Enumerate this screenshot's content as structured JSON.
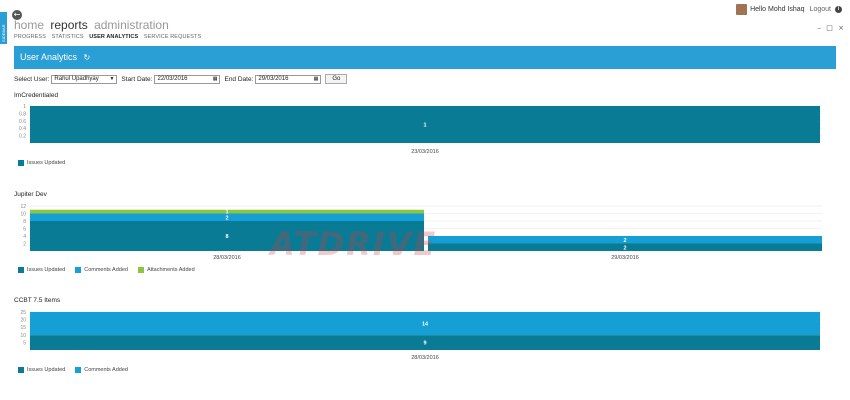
{
  "window": {
    "side_tab_label": "SIDEBAR",
    "controls": [
      "–",
      "□",
      "×"
    ]
  },
  "nav": {
    "back_icon": "back-arrow-icon",
    "top": [
      {
        "label": "home",
        "active": false
      },
      {
        "label": "reports",
        "active": true
      },
      {
        "label": "administration",
        "active": false
      }
    ],
    "sub": [
      {
        "label": "PROGRESS",
        "active": false
      },
      {
        "label": "STATISTICS",
        "active": false
      },
      {
        "label": "USER ANALYTICS",
        "active": true
      },
      {
        "label": "SERVICE REQUESTS",
        "active": false
      }
    ]
  },
  "user": {
    "greeting": "Hello Mohd Ishaq",
    "logout": "Logout",
    "info": "i"
  },
  "banner": {
    "title": "User Analytics",
    "refresh_icon": "refresh-icon"
  },
  "filters": {
    "user_label": "Select User:",
    "user_value": "Rahul  Upadhyay",
    "start_label": "Start Date:",
    "start_value": "22/03/2016",
    "end_label": "End Date:",
    "end_value": "29/03/2016",
    "go_label": "Go"
  },
  "colors": {
    "issues": "#0a7b94",
    "comments": "#159fd4",
    "attachments": "#8cc63f",
    "banner": "#2a9fd6"
  },
  "chart_data": [
    {
      "type": "bar",
      "title": "ImCredentialed",
      "categories": [
        "23/03/2016"
      ],
      "series": [
        {
          "name": "Issues Updated",
          "values": [
            1
          ]
        }
      ],
      "y_ticks": [
        "1",
        "0.8",
        "0.6",
        "0.4",
        "0.2"
      ],
      "ylim": [
        0,
        1
      ]
    },
    {
      "type": "bar",
      "title": "Jupiter Dev",
      "categories": [
        "28/03/2016",
        "29/03/2016"
      ],
      "series": [
        {
          "name": "Issues Updated",
          "values": [
            8,
            2
          ]
        },
        {
          "name": "Comments Added",
          "values": [
            2,
            2
          ]
        },
        {
          "name": "Attachments Added",
          "values": [
            1,
            0
          ]
        }
      ],
      "y_ticks": [
        "12",
        "10",
        "8",
        "6",
        "4",
        "2"
      ],
      "ylim": [
        0,
        12
      ]
    },
    {
      "type": "bar",
      "title": "CCBT 7.5 Items",
      "categories": [
        "28/03/2016"
      ],
      "series": [
        {
          "name": "Issues Updated",
          "values": [
            9
          ]
        },
        {
          "name": "Comments Added",
          "values": [
            14
          ]
        }
      ],
      "y_ticks": [
        "25",
        "20",
        "15",
        "10",
        "5"
      ],
      "ylim": [
        0,
        23
      ]
    }
  ],
  "watermark": "ATDRIVE"
}
